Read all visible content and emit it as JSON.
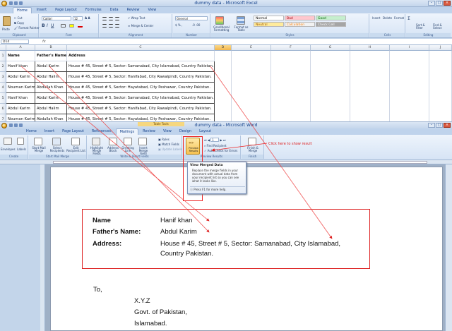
{
  "excel": {
    "title": "dummy data - Microsoft Excel",
    "tabs": [
      "Home",
      "Insert",
      "Page Layout",
      "Formulas",
      "Data",
      "Review",
      "View"
    ],
    "active_tab": "Home",
    "clipboard": {
      "paste": "Paste",
      "cut": "Cut",
      "copy": "Copy",
      "format_painter": "Format Painter",
      "label": "Clipboard"
    },
    "font": {
      "name": "Calibri",
      "size": "12",
      "label": "Font"
    },
    "alignment": {
      "wrap": "Wrap Text",
      "merge": "Merge & Center",
      "label": "Alignment"
    },
    "number": {
      "format": "General",
      "label": "Number"
    },
    "styles": {
      "conditional": "Conditional Formatting",
      "format_table": "Format as Table",
      "cells": [
        {
          "label": "Normal",
          "bg": "#ffffff",
          "fg": "#000000"
        },
        {
          "label": "Bad",
          "bg": "#ffc7ce",
          "fg": "#9c0006"
        },
        {
          "label": "Good",
          "bg": "#c6efce",
          "fg": "#006100"
        },
        {
          "label": "Neutral",
          "bg": "#ffeb9c",
          "fg": "#9c5700"
        },
        {
          "label": "Calculation",
          "bg": "#f2f2f2",
          "fg": "#fa7d00"
        },
        {
          "label": "Check Cell",
          "bg": "#a5a5a5",
          "fg": "#ffffff"
        }
      ],
      "label": "Styles"
    },
    "cells_group": {
      "insert": "Insert",
      "delete": "Delete",
      "format": "Format",
      "label": "Cells"
    },
    "editing": {
      "sort": "Sort & Filter",
      "find": "Find & Select",
      "label": "Editing"
    },
    "name_box": "D14",
    "fx": "fx",
    "columns": [
      "A",
      "B",
      "C",
      "D",
      "E",
      "F",
      "G",
      "H",
      "I",
      "J"
    ],
    "rows": [
      [
        "Name",
        "Father's Name",
        "Address"
      ],
      [
        "Hanif khan",
        "Abdul Karim",
        "House # 45, Street # 5, Sector: Samanabad, City Islamabad, Country Pakistan."
      ],
      [
        "Abdul Karim",
        "Abdul Halim",
        "House # 45, Street # 5, Sector: Hanifabad, City Rawalpindi, Country Pakistan."
      ],
      [
        "Nouman Karim",
        "Abdullah Khan",
        "House # 45, Street # 5, Sector: Hayatabad, City Peshawar, Country Pakistan."
      ],
      [
        "Hanif khan",
        "Abdul Karim",
        "House # 45, Street # 5, Sector: Samanabad, City Islamabad, Country Pakistan."
      ],
      [
        "Abdul Karim",
        "Abdul Halim",
        "House # 45, Street # 5, Sector: Hanifabad, City Rawalpindi, Country Pakistan."
      ],
      [
        "Nouman Karim",
        "Abdullah Khan",
        "House # 45, Street # 5, Sector: Hayatabad, City Peshawar, Country Pakistan."
      ]
    ],
    "row_numbers": [
      "1",
      "2",
      "3",
      "4",
      "5",
      "6",
      "7"
    ]
  },
  "word": {
    "title": "dummy data - Microsoft Word",
    "table_tools": "Table Tools",
    "tabs": [
      "Home",
      "Insert",
      "Page Layout",
      "References",
      "Mailings",
      "Review",
      "View",
      "Design",
      "Layout"
    ],
    "active_tab": "Mailings",
    "ribbon": {
      "envelopes": "Envelopes",
      "labels": "Labels",
      "create_label": "Create",
      "start_merge": "Start Mail Merge",
      "select_recipients": "Select Recipients",
      "edit_list": "Edit Recipient List",
      "start_label": "Start Mail Merge",
      "highlight": "Highlight Merge Fields",
      "address_block": "Address Block",
      "greeting": "Greeting Line",
      "insert_field": "Insert Merge Field",
      "rules": "Rules",
      "match": "Match Fields",
      "update": "Update Labels",
      "write_label": "Write & Insert Fields",
      "preview": "Preview Results",
      "record": "1",
      "find_recipient": "Find Recipient",
      "auto_check": "Auto Check for Errors",
      "preview_label": "Preview Results",
      "finish": "Finish & Merge",
      "finish_label": "Finish"
    },
    "tooltip": {
      "title": "View Merged Data",
      "body": "Replace the merge fields in your document with actual data from your recipient list so you can see what it looks like.",
      "help": "Press F1 for more help."
    },
    "callout": "Click here to show result",
    "doc": {
      "name_label": "Name",
      "name_value": "Hanif khan",
      "father_label": "Father's Name:",
      "father_value": "Abdul Karim",
      "address_label": "Address:",
      "address_line1": "House # 45, Street # 5, Sector: Samanabad, City Islamabad,",
      "address_line2": "Country Pakistan.",
      "to": "To,",
      "recipient": "X.Y.Z",
      "org": "Govt. of Pakistan,",
      "city": "Islamabad."
    }
  }
}
